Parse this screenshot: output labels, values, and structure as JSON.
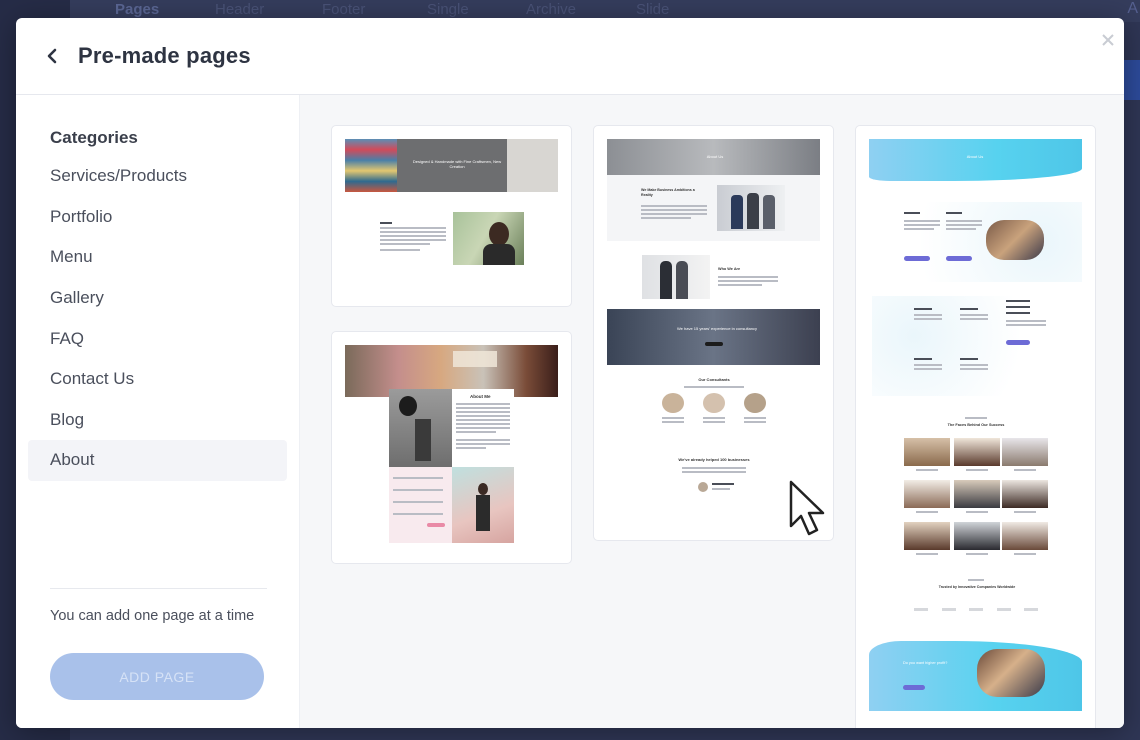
{
  "background": {
    "tabs": [
      "Pages",
      "Header",
      "Footer",
      "Single",
      "Archive",
      "Slide"
    ],
    "right_text": "A"
  },
  "modal": {
    "title": "Pre-made pages",
    "icons": {
      "back": "chevron-left-icon",
      "close": "close-icon"
    }
  },
  "sidebar": {
    "heading": "Categories",
    "items": [
      {
        "label": "Services/Products",
        "active": false
      },
      {
        "label": "Portfolio",
        "active": false
      },
      {
        "label": "Menu",
        "active": false
      },
      {
        "label": "Gallery",
        "active": false
      },
      {
        "label": "FAQ",
        "active": false
      },
      {
        "label": "Contact Us",
        "active": false
      },
      {
        "label": "Blog",
        "active": false
      },
      {
        "label": "About",
        "active": true
      }
    ],
    "note": "You can add one page at a time",
    "add_button": "ADD PAGE"
  },
  "templates": {
    "card1": {
      "hero_text": "Designed & Handmade with Fine Craftsmen, New Creation"
    },
    "card2": {
      "hero_text": "About Me"
    },
    "card3": {
      "hero_text": "About Us",
      "headline": "We Make Business Ambitions a Reality",
      "who": "Who We Are",
      "banner": "We have 15 years' experience in consultancy",
      "team": "Our Consultants",
      "helped": "We've already helped 100 businesses"
    },
    "card4": {
      "hero_text": "About Us",
      "faces": "The Faces Behind Our Success",
      "trusted": "Trusted by Innovative Companies Worldwide",
      "cta": "Do you want higher profit?"
    }
  },
  "colors": {
    "accent": "#6d6bd6",
    "button_disabled": "#a9c1ea",
    "cyan": "#57d2ef"
  }
}
